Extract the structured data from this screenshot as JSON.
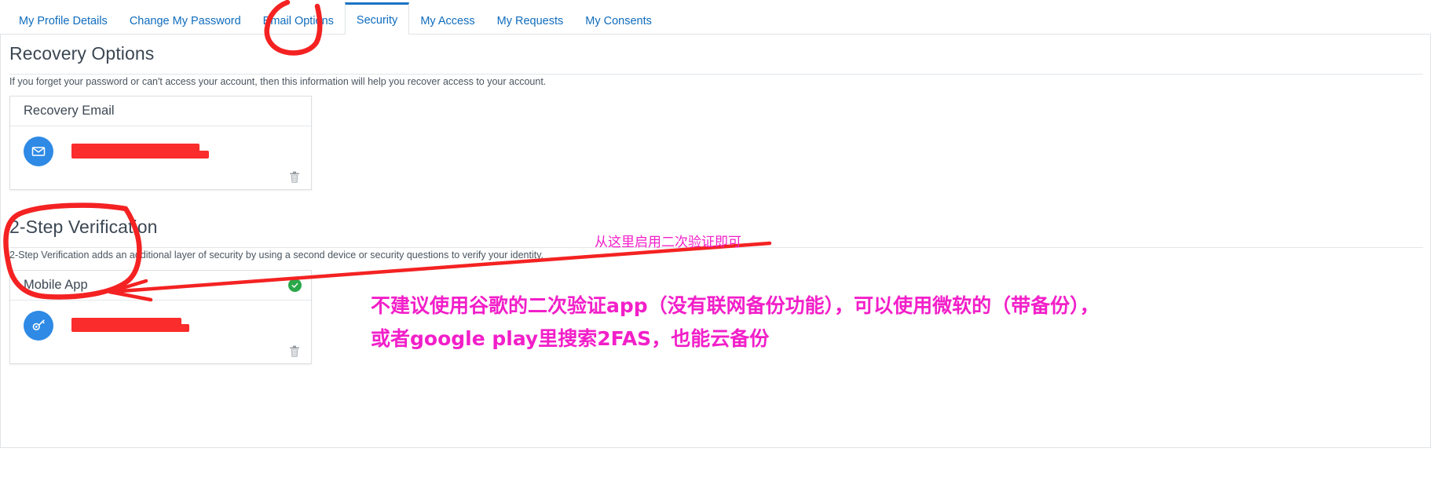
{
  "tabs": [
    {
      "label": "My Profile Details",
      "active": false
    },
    {
      "label": "Change My Password",
      "active": false
    },
    {
      "label": "Email Options",
      "active": false
    },
    {
      "label": "Security",
      "active": true
    },
    {
      "label": "My Access",
      "active": false
    },
    {
      "label": "My Requests",
      "active": false
    },
    {
      "label": "My Consents",
      "active": false
    }
  ],
  "recovery": {
    "title": "Recovery Options",
    "description": "If you forget your password or can't access your account, then this information will help you recover access to your account.",
    "card": {
      "title": "Recovery Email",
      "icon": "envelope-icon",
      "value_redacted": true,
      "delete_icon": "trash-icon"
    }
  },
  "two_step": {
    "title": "2-Step Verification",
    "description": "2-Step Verification adds an additional layer of security by using a second device or security questions to verify your identity.",
    "card": {
      "title": "Mobile App",
      "icon": "mobile-app-icon",
      "status_icon": "check-circle-icon",
      "value_redacted": true,
      "delete_icon": "trash-icon"
    }
  },
  "annotations": {
    "small_note": "从这里启用二次验证即可",
    "big_note_line1": "不建议使用谷歌的二次验证app（没有联网备份功能），可以使用微软的（带备份），",
    "big_note_line2": "或者google play里搜索2FAS，也能云备份"
  },
  "colors": {
    "tab_active": "#1b74c4",
    "link": "#0f6cbd",
    "avatar_blue": "#2e8ae5",
    "marker_red": "#fa2c2c",
    "status_green": "#2aa84a",
    "annotation_magenta": "#f21fc9"
  }
}
